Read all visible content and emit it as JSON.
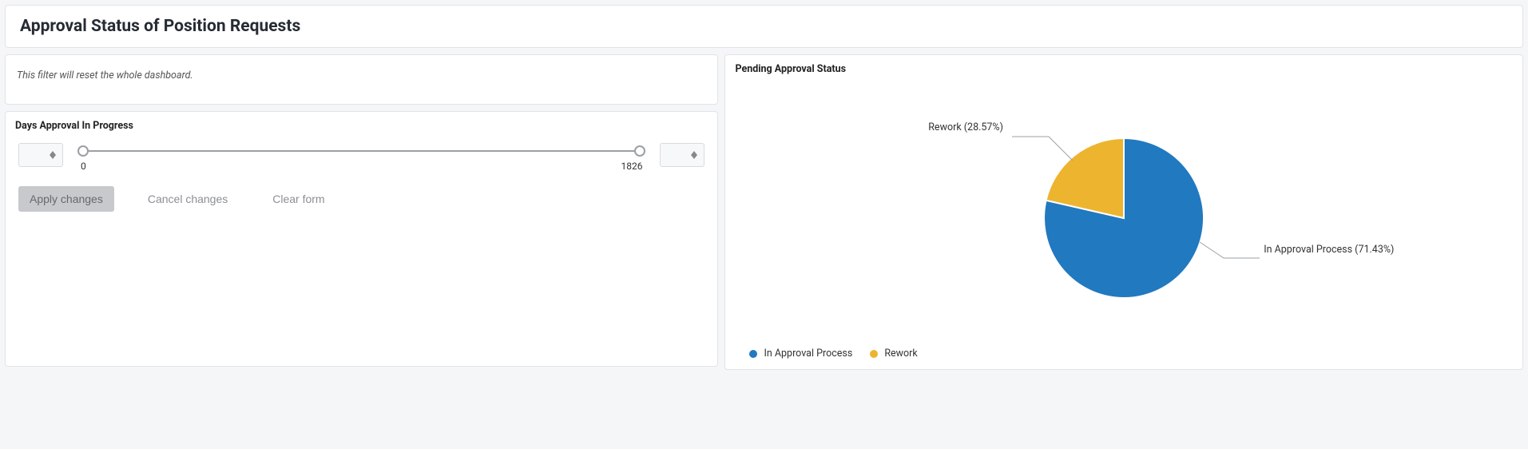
{
  "header": {
    "title": "Approval Status of Position Requests"
  },
  "filter_note": "This filter will reset the whole dashboard.",
  "days_panel": {
    "title": "Days Approval In Progress",
    "min": "0",
    "max": "1826",
    "apply": "Apply changes",
    "cancel": "Cancel changes",
    "clear": "Clear form"
  },
  "chart_panel": {
    "title": "Pending Approval Status",
    "label_in_approval": "In Approval Process (71.43%)",
    "label_rework": "Rework (28.57%)",
    "legend_in_approval": "In Approval Process",
    "legend_rework": "Rework"
  },
  "colors": {
    "blue": "#2179c0",
    "yellow": "#edb42f"
  },
  "chart_data": {
    "type": "pie",
    "title": "Pending Approval Status",
    "series": [
      {
        "name": "In Approval Process",
        "value": 71.43,
        "color": "#2179c0"
      },
      {
        "name": "Rework",
        "value": 28.57,
        "color": "#edb42f"
      }
    ]
  }
}
